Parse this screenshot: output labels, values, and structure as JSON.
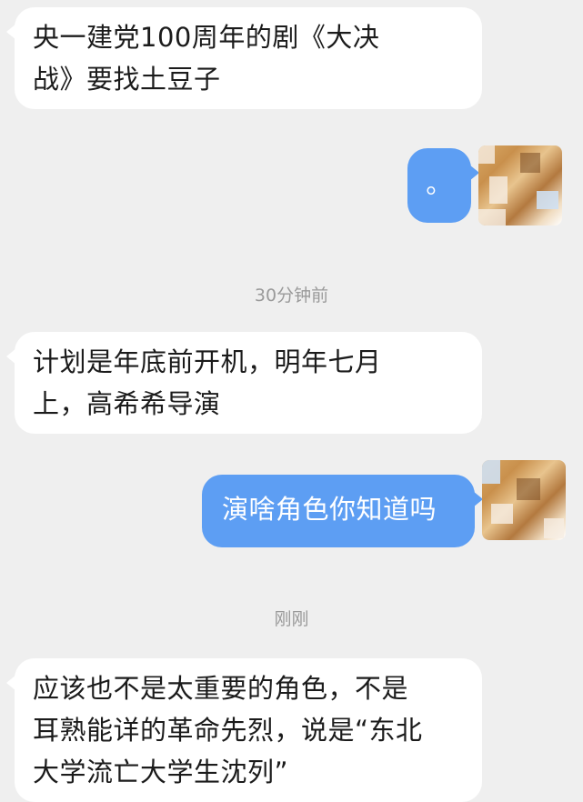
{
  "messages": [
    {
      "id": "m1",
      "side": "in",
      "text": "央一建党100周年的剧《大决\n战》要找土豆子"
    },
    {
      "id": "m2",
      "side": "out",
      "text": "。"
    },
    {
      "id": "t1",
      "type": "timestamp",
      "text": "30分钟前"
    },
    {
      "id": "m3",
      "side": "in",
      "text": "计划是年底前开机，明年七月\n上，高希希导演"
    },
    {
      "id": "m4",
      "side": "out",
      "text": "演啥角色你知道吗"
    },
    {
      "id": "t2",
      "type": "timestamp",
      "text": "刚刚"
    },
    {
      "id": "m5",
      "side": "in",
      "text": "应该也不是太重要的角色，不是\n耳熟能详的革命先烈，说是“东北\n大学流亡大学生沈列”"
    }
  ],
  "colors": {
    "background": "#efefef",
    "incoming_bubble": "#ffffff",
    "outgoing_bubble": "#5d9ef3",
    "timestamp_text": "#9a9a9a"
  },
  "icons": {
    "avatar": "pixelated-lion-avatar"
  }
}
